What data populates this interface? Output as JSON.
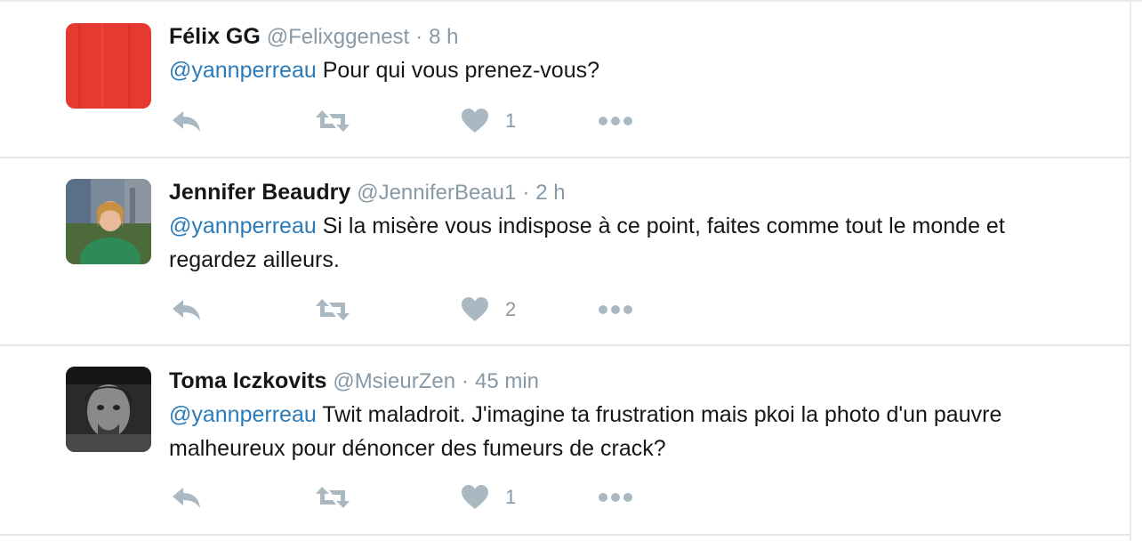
{
  "tweets": [
    {
      "name": "Félix GG",
      "handle": "@Felixggenest",
      "separator": "·",
      "time": "8 h",
      "mention": "@yannperreau",
      "text": " Pour qui vous prenez-vous?",
      "likes": "1",
      "avatar_color": "#e0302c"
    },
    {
      "name": "Jennifer Beaudry",
      "handle": "@JenniferBeau1",
      "separator": "·",
      "time": "2 h",
      "mention": "@yannperreau",
      "text": " Si la misère vous indispose à ce point, faites comme tout le monde et regardez ailleurs.",
      "likes": "2",
      "avatar_color": "#2e8b57"
    },
    {
      "name": "Toma Iczkovits",
      "handle": "@MsieurZen",
      "separator": "·",
      "time": "45 min",
      "mention": "@yannperreau",
      "text": " Twit maladroit. J'imagine ta frustration mais pkoi la photo d'un pauvre malheureux pour dénoncer des fumeurs de crack?",
      "likes": "1",
      "avatar_color": "#3a3a3a"
    }
  ],
  "icons": {
    "reply": "reply-icon",
    "retweet": "retweet-icon",
    "like": "heart-icon",
    "more": "more-dots-icon"
  },
  "colors": {
    "link": "#2b7bb9",
    "muted": "#8899a6",
    "icon": "#aab8c2",
    "divider": "#e1e8ed"
  }
}
